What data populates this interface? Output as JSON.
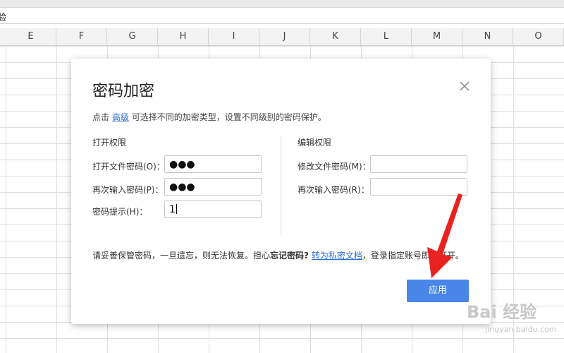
{
  "spreadsheet": {
    "formula_text": "验",
    "columns": [
      "E",
      "F",
      "G",
      "H",
      "I",
      "J",
      "K",
      "L",
      "M",
      "N",
      "O"
    ]
  },
  "dialog": {
    "title": "密码加密",
    "close_icon": "close-icon",
    "description": {
      "prefix": "点击",
      "link": "高级",
      "suffix": "可选择不同的加密类型，设置不同级别的密码保护。"
    },
    "open_section": {
      "title": "打开权限",
      "password_label": "打开文件密码(O)：",
      "password_value": "●●●",
      "confirm_label": "再次输入密码(P)：",
      "confirm_value": "●●●",
      "hint_label": "密码提示(H)：",
      "hint_value": "1"
    },
    "edit_section": {
      "title": "编辑权限",
      "password_label": "修改文件密码(M)：",
      "password_value": "",
      "confirm_label": "再次输入密码(R)：",
      "confirm_value": ""
    },
    "warning": {
      "text1": "请妥善保管密码，一旦遗忘，则无法恢复。担心",
      "bold": "忘记密码?",
      "link": "转为私密文档",
      "text2": "，登录指定账号即可打开。"
    },
    "apply_label": "应用"
  },
  "watermark": {
    "main": "Bai 经验",
    "sub": "jingyan.baidu.com"
  },
  "colors": {
    "accent": "#4a86e8",
    "link": "#2b6cd1",
    "annotation_arrow": "#e8231f"
  }
}
